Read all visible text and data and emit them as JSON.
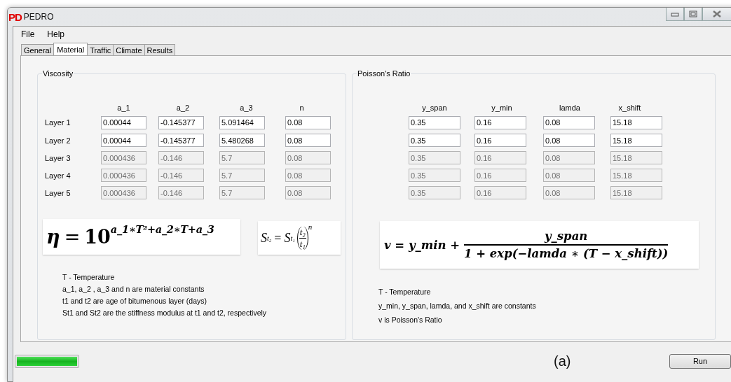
{
  "window": {
    "logo": "PD",
    "title": "PEDRO"
  },
  "menu": [
    "File",
    "Help"
  ],
  "tabs": [
    {
      "label": "General",
      "selected": false
    },
    {
      "label": "Material",
      "selected": true
    },
    {
      "label": "Traffic",
      "selected": false
    },
    {
      "label": "Climate",
      "selected": false
    },
    {
      "label": "Results",
      "selected": false
    }
  ],
  "viscosity": {
    "title": "Viscosity",
    "columns": [
      "a_1",
      "a_2",
      "a_3",
      "n"
    ],
    "rows": [
      {
        "label": "Layer 1",
        "disabled": false,
        "values": [
          "0.00044",
          "-0.145377",
          "5.091464",
          "0.08"
        ]
      },
      {
        "label": "Layer 2",
        "disabled": false,
        "values": [
          "0.00044",
          "-0.145377",
          "5.480268",
          "0.08"
        ]
      },
      {
        "label": "Layer 3",
        "disabled": true,
        "values": [
          "0.000436",
          "-0.146",
          "5.7",
          "0.08"
        ]
      },
      {
        "label": "Layer 4",
        "disabled": true,
        "values": [
          "0.000436",
          "-0.146",
          "5.7",
          "0.08"
        ]
      },
      {
        "label": "Layer 5",
        "disabled": true,
        "values": [
          "0.000436",
          "-0.146",
          "5.7",
          "0.08"
        ]
      }
    ],
    "formula": {
      "lhs": "η",
      "eq": "=",
      "base": "10",
      "exponent": "a_1∗T²+a_2∗T+a_3"
    },
    "stiffness_formula": {
      "lhs": "S",
      "lhs_sub": "t₂",
      "eq": "=",
      "rhs": "S",
      "rhs_sub": "t₁",
      "numerator": "t₂",
      "denominator": "t₁",
      "power": "n"
    },
    "notes": [
      "T - Temperature",
      "a_1, a_2 , a_3 and n  are material constants",
      "t1 and t2 are age of bitumenous layer (days)",
      "St1 and St2 are the stiffness modulus at t1 and t2, respectively"
    ]
  },
  "poisson": {
    "title": "Poisson's Ratio",
    "columns": [
      "y_span",
      "y_min",
      "lamda",
      "x_shift"
    ],
    "rows": [
      {
        "disabled": false,
        "values": [
          "0.35",
          "0.16",
          "0.08",
          "15.18"
        ]
      },
      {
        "disabled": false,
        "values": [
          "0.35",
          "0.16",
          "0.08",
          "15.18"
        ]
      },
      {
        "disabled": true,
        "values": [
          "0.35",
          "0.16",
          "0.08",
          "15.18"
        ]
      },
      {
        "disabled": true,
        "values": [
          "0.35",
          "0.16",
          "0.08",
          "15.18"
        ]
      },
      {
        "disabled": true,
        "values": [
          "0.35",
          "0.16",
          "0.08",
          "15.18"
        ]
      }
    ],
    "formula": {
      "lhs": "v = y_min +",
      "numerator": "y_span",
      "denominator": "1 + exp(−lamda ∗ (T − x_shift))"
    },
    "notes": [
      "T - Temperature",
      "y_min, y_span, lamda, and x_shift are constants",
      "v is Poisson's Ratio"
    ]
  },
  "progress": {
    "level": 1
  },
  "caption": "(a)",
  "run_button": "Run"
}
